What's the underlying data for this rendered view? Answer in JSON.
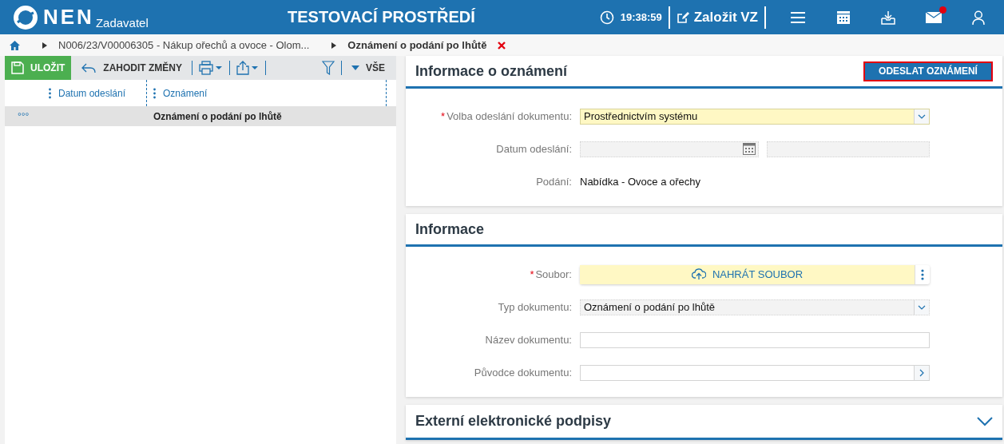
{
  "header": {
    "logo": "NEN",
    "subtitle": "Zadavatel",
    "title": "TESTOVACÍ PROSTŘEDÍ",
    "time": "19:38:59",
    "create_label": "Založit VZ",
    "mail_unread": true
  },
  "breadcrumb": [
    {
      "label": "N006/23/V00006305 - Nákup ořechů a ovoce - Olom...",
      "current": false
    },
    {
      "label": "Oznámení o podání po lhůtě",
      "current": true
    }
  ],
  "toolbar": {
    "save": "ULOŽIT",
    "discard": "ZAHODIT ZMĚNY",
    "filter": "VŠE"
  },
  "table": {
    "columns": [
      "Datum odeslání",
      "Oznámení"
    ],
    "rows": [
      {
        "menu": "°°°",
        "column_2": "Oznámení o podání po lhůtě",
        "selected": true
      }
    ]
  },
  "required_mark": "*",
  "sections": [
    {
      "title": "Informace o oznámení",
      "action": "ODESLAT OZNÁMENÍ",
      "collapsed": false,
      "fields": [
        {
          "kind": "select",
          "label": "Volba odeslání dokumentu:",
          "required": true,
          "disabled": false,
          "value": "Prostřednictvím systému"
        },
        {
          "kind": "date",
          "label": "Datum odeslání:",
          "required": false,
          "disabled": true
        },
        {
          "kind": "static",
          "label": "Podání:",
          "required": false,
          "value": "Nabídka - Ovoce a ořechy"
        }
      ]
    },
    {
      "title": "Informace",
      "collapsed": false,
      "fields": [
        {
          "kind": "upload",
          "label": "Soubor:",
          "required": true,
          "value": "NAHRÁT SOUBOR"
        },
        {
          "kind": "select",
          "label": "Typ dokumentu:",
          "required": false,
          "disabled": true,
          "value": "Oznámení o podání po lhůtě"
        },
        {
          "kind": "input",
          "label": "Název dokumentu:",
          "required": false,
          "disabled": false
        },
        {
          "kind": "lookup",
          "label": "Původce dokumentu:",
          "required": false,
          "disabled": false
        }
      ]
    },
    {
      "title": "Externí elektronické podpisy",
      "collapsed": true
    }
  ]
}
